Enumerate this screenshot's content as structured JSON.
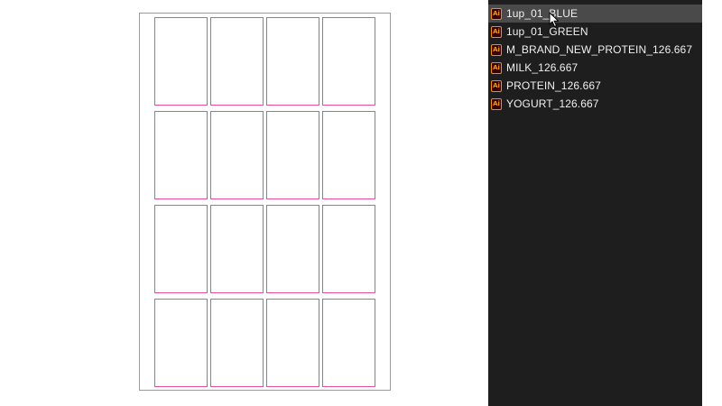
{
  "artboard": {
    "grid": {
      "rows": 4,
      "columns": 4
    }
  },
  "file_list": {
    "items": [
      {
        "label": "1up_01_BLUE",
        "icon": "ai-file-icon",
        "icon_text": "Ai",
        "selected": true
      },
      {
        "label": "1up_01_GREEN",
        "icon": "ai-file-icon",
        "icon_text": "Ai",
        "selected": false
      },
      {
        "label": "M_BRAND_NEW_PROTEIN_126.667",
        "icon": "ai-file-icon",
        "icon_text": "Ai",
        "selected": false
      },
      {
        "label": "MILK_126.667",
        "icon": "ai-file-icon",
        "icon_text": "Ai",
        "selected": false
      },
      {
        "label": "PROTEIN_126.667",
        "icon": "ai-file-icon",
        "icon_text": "Ai",
        "selected": false
      },
      {
        "label": "YOGURT_126.667",
        "icon": "ai-file-icon",
        "icon_text": "Ai",
        "selected": false
      }
    ]
  },
  "colors": {
    "panel_background": "#1e1e1e",
    "selected_row": "#4a4a4a",
    "cell_border": "#e64f9a",
    "ai_icon_accent": "#ff8a00"
  }
}
